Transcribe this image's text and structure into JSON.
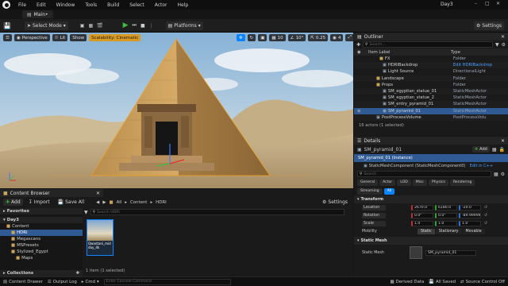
{
  "titlebar": {
    "menus": [
      "File",
      "Edit",
      "Window",
      "Tools",
      "Build",
      "Select",
      "Actor",
      "Help"
    ],
    "project": "Day3"
  },
  "tabs": {
    "level_tab": "Main•"
  },
  "toolbar": {
    "select_mode": "Select Mode",
    "platforms": "Platforms",
    "settings": "Settings"
  },
  "viewport": {
    "perspective": "Perspective",
    "lit": "Lit",
    "show": "Show",
    "scalability": "Scalability: Cinematic",
    "grid_snap": "10",
    "rot_snap": "10°",
    "scale_snap": "0.25",
    "cam_speed": "4"
  },
  "outliner": {
    "title": "Outliner",
    "search_placeholder": "Search...",
    "col_label": "Item Label",
    "col_type": "Type",
    "rows": [
      {
        "label": "FX",
        "type": "Folder"
      },
      {
        "label": "HDRIBackdrop",
        "type": "Edit HDRIBackdrop"
      },
      {
        "label": "Light Source",
        "type": "DirectionalLight"
      },
      {
        "label": "Landscape",
        "type": "Folder"
      },
      {
        "label": "Props",
        "type": "Folder"
      },
      {
        "label": "SM_egyptian_statue_01",
        "type": "StaticMeshActor"
      },
      {
        "label": "SM_egyptian_statue_2",
        "type": "StaticMeshActor"
      },
      {
        "label": "SM_entry_pyramid_01",
        "type": "StaticMeshActor"
      },
      {
        "label": "SM_pyramid_01",
        "type": "StaticMeshActor"
      },
      {
        "label": "PostProcessVolume",
        "type": "PostProcessVolu"
      }
    ],
    "footer": "16 actors (1 selected)"
  },
  "details": {
    "title": "Details",
    "actor_name": "SM_pyramid_01",
    "add_label": "Add",
    "instance_row": "SM_pyramid_01 (Instance)",
    "component_row": "StaticMeshComponent (StaticMeshComponent0)",
    "edit_cpp": "Edit in C++",
    "search_placeholder": "Search",
    "tabs_row1": [
      "General",
      "Actor",
      "LOD",
      "Misc",
      "Physics",
      "Rendering"
    ],
    "tabs_row2": [
      "Streaming",
      "All"
    ],
    "section_transform": "Transform",
    "location_label": "Location",
    "location": [
      "2670.0",
      "6180.0",
      "-20.0"
    ],
    "rotation_label": "Rotation",
    "rotation": [
      "0.0°",
      "0.0°",
      "-89.99999°"
    ],
    "scale_label": "Scale",
    "scale": [
      "1.0",
      "1.0",
      "1.0"
    ],
    "mobility_label": "Mobility",
    "mobility_options": [
      "Static",
      "Stationary",
      "Movable"
    ],
    "section_mesh": "Static Mesh",
    "static_mesh_label": "Static Mesh",
    "static_mesh_value": "SM_pyramid_01"
  },
  "content_browser": {
    "title": "Content Browser",
    "add_label": "Add",
    "import_label": "Import",
    "save_all_label": "Save All",
    "breadcrumb": [
      "All",
      "Content",
      "HDRI"
    ],
    "settings": "Settings",
    "favorites": "Favorites",
    "project_root": "Day3",
    "tree": [
      "Content",
      "HDRI",
      "Megascans",
      "MSPresets",
      "Stylized_Egypt",
      "Maps"
    ],
    "search_placeholder": "Search HDRI",
    "asset_name": "Qwantani_midday_4k",
    "status": "1 item (1 selected)",
    "collections": "Collections"
  },
  "statusbar": {
    "content_drawer": "Content Drawer",
    "output_log": "Output Log",
    "cmd": "Cmd",
    "console_placeholder": "Enter Console Command",
    "derived_data": "Derived Data",
    "all_saved": "All Saved",
    "source_control": "Source Control Off"
  },
  "colors": {
    "accent": "#0a84ff",
    "selection": "#2f5a93",
    "play_green": "#3fbf3f",
    "scalability": "#d89a20",
    "add_green": "#3aa33a"
  }
}
